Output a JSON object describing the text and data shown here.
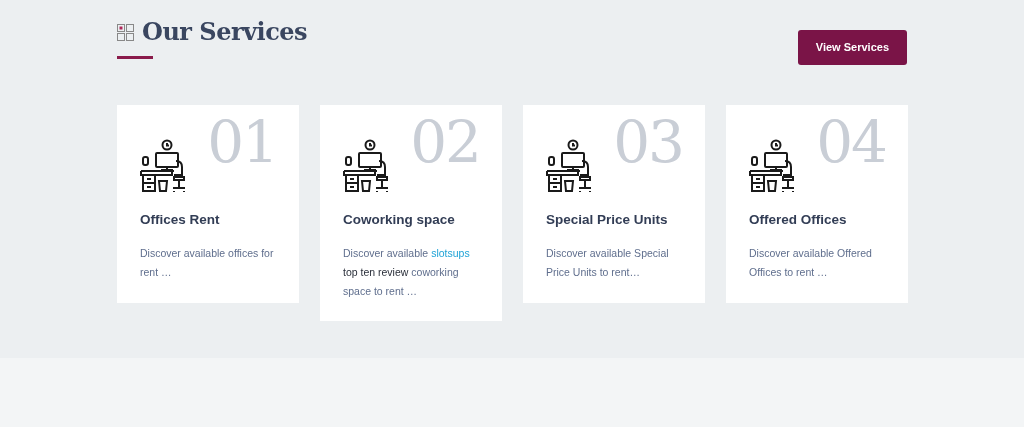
{
  "section": {
    "title": "Our Services",
    "button": "View Services"
  },
  "cards": [
    {
      "number": "01",
      "title": "Offices Rent",
      "description": [
        {
          "kind": "text",
          "text": "Discover available offices for rent …"
        }
      ]
    },
    {
      "number": "02",
      "title": "Coworking space",
      "description": [
        {
          "kind": "text",
          "text": "Discover available "
        },
        {
          "kind": "link",
          "text": "slotsups"
        },
        {
          "kind": "dark",
          "text": " top ten review "
        },
        {
          "kind": "text",
          "text": "coworking space to rent …"
        }
      ]
    },
    {
      "number": "03",
      "title": "Special Price Units",
      "description": [
        {
          "kind": "text",
          "text": "Discover available Special Price Units to rent…"
        }
      ]
    },
    {
      "number": "04",
      "title": "Offered Offices",
      "description": [
        {
          "kind": "text",
          "text": "Discover available Offered Offices to rent …"
        }
      ]
    }
  ]
}
